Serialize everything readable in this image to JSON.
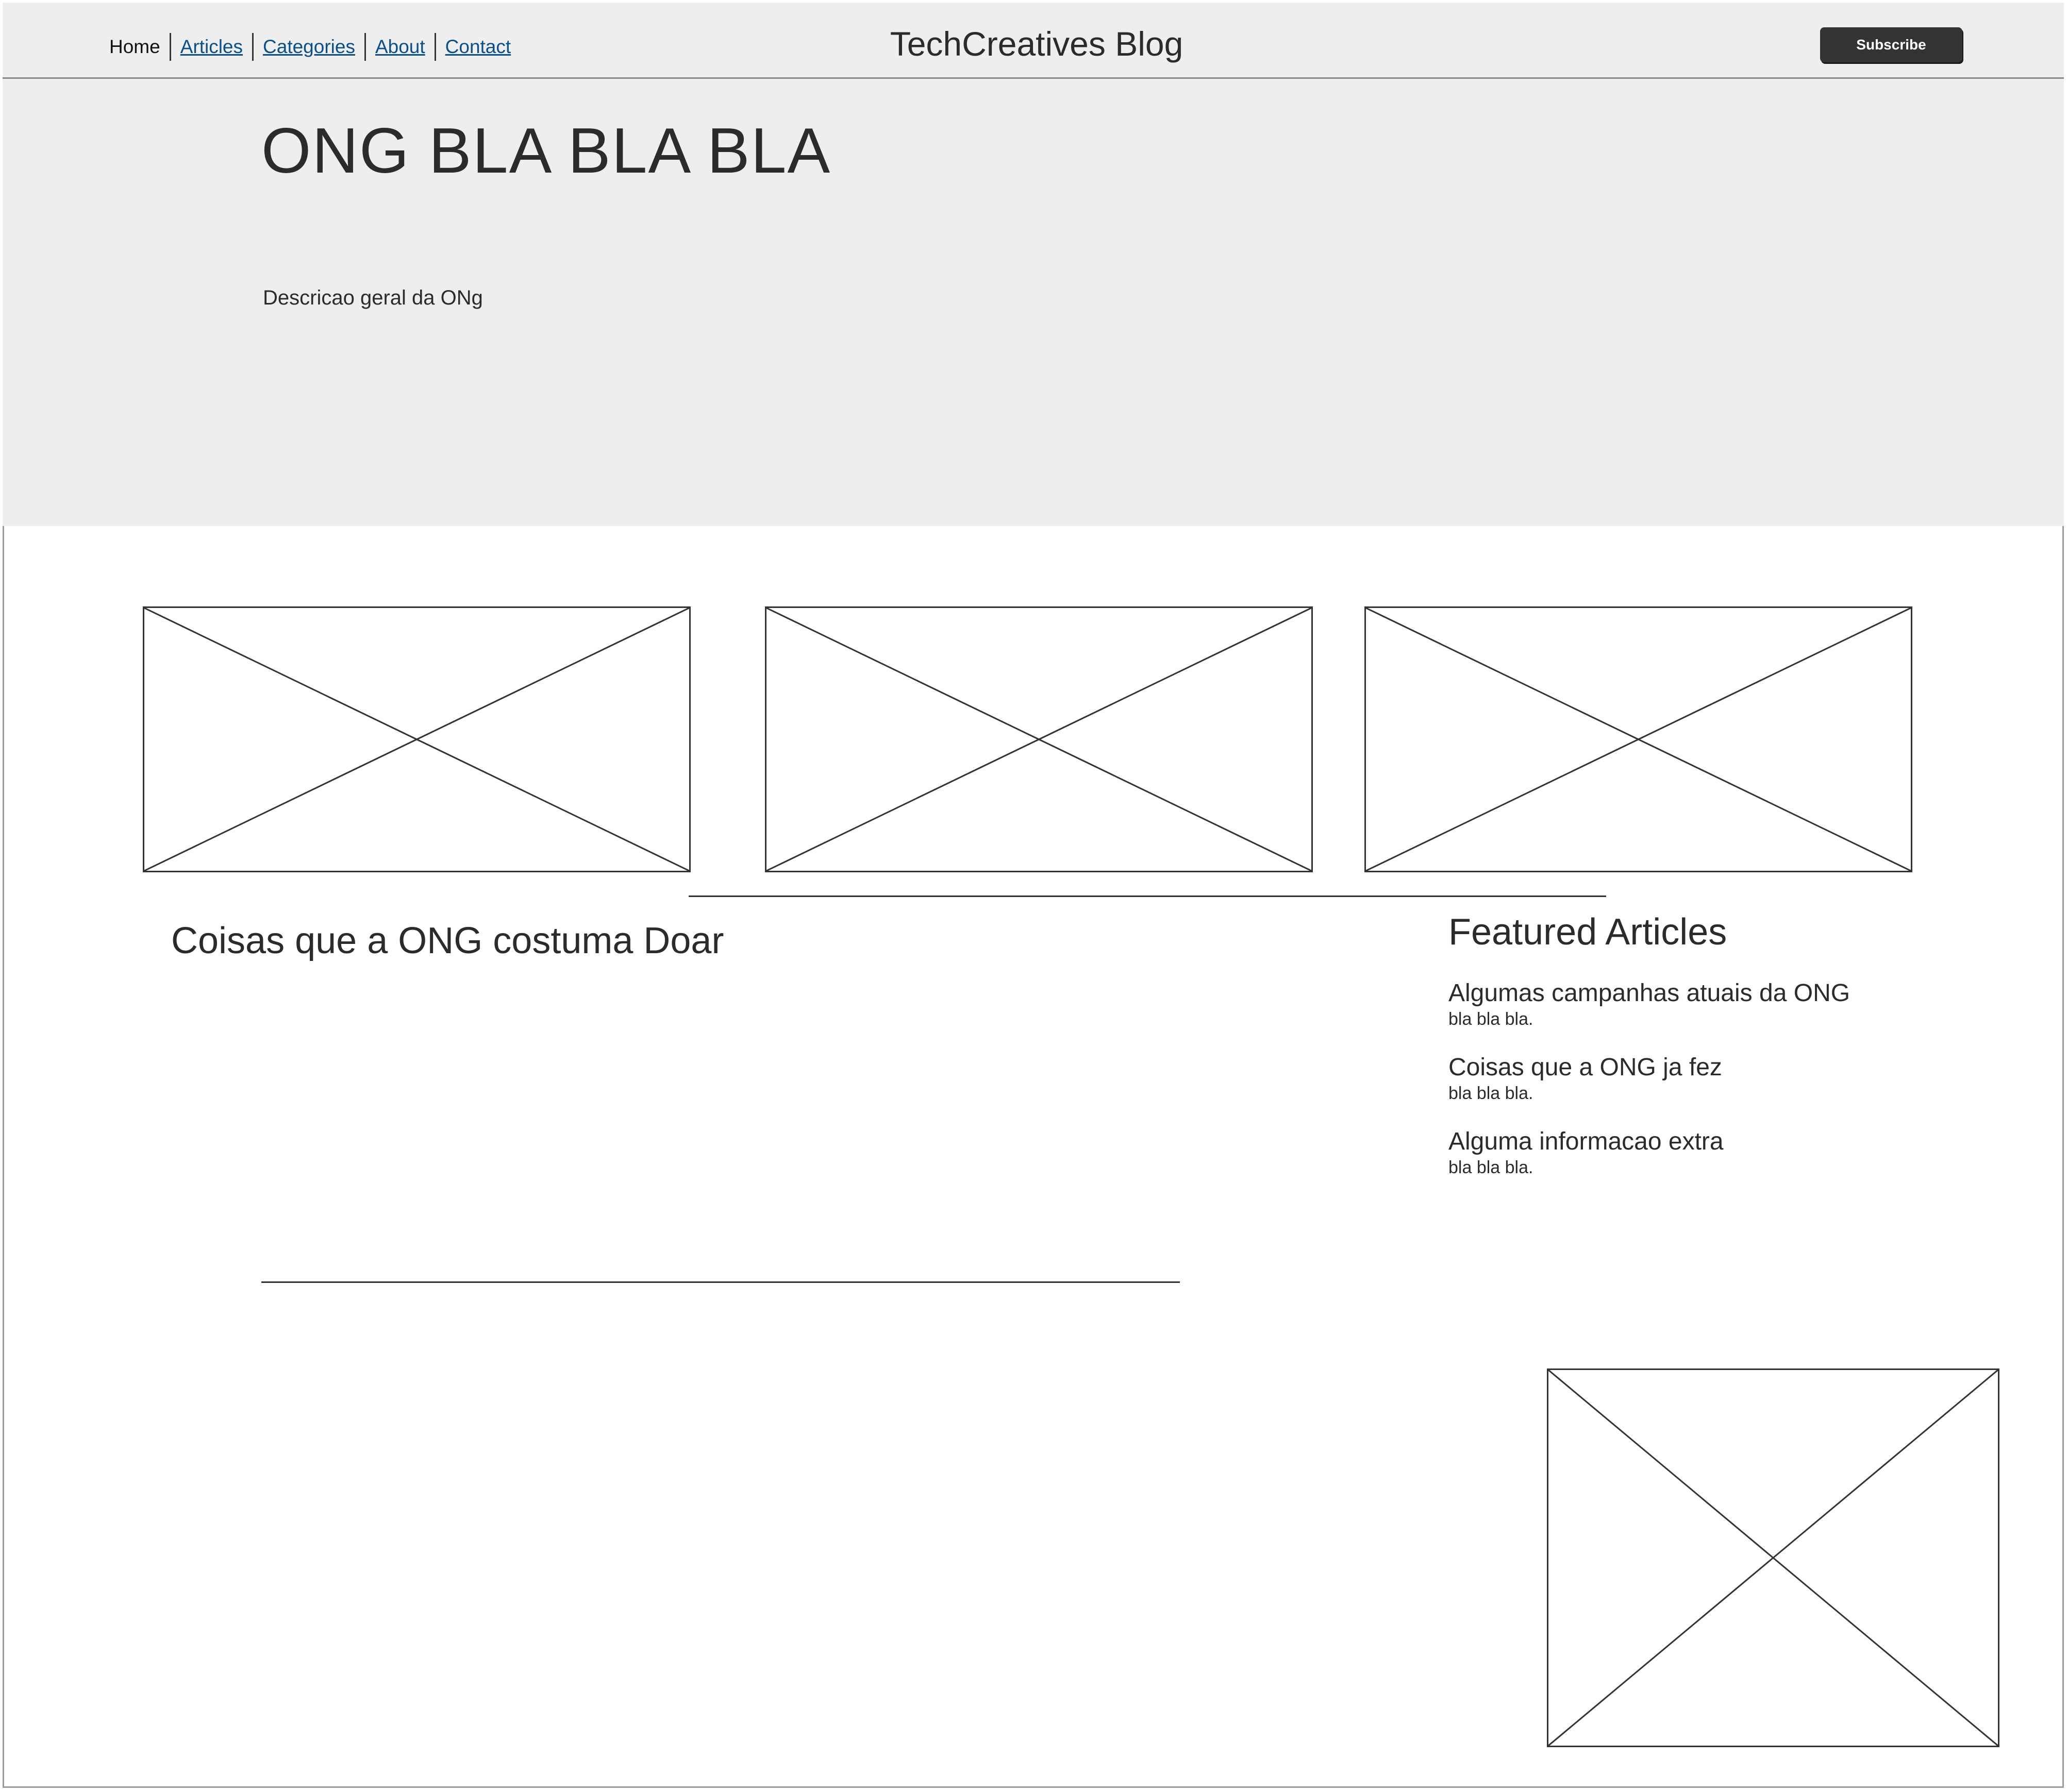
{
  "header": {
    "nav": [
      {
        "label": "Home",
        "current": true
      },
      {
        "label": "Articles",
        "current": false
      },
      {
        "label": "Categories",
        "current": false
      },
      {
        "label": "About",
        "current": false
      },
      {
        "label": "Contact",
        "current": false
      }
    ],
    "site_title": "TechCreatives Blog",
    "subscribe_label": "Subscribe"
  },
  "hero": {
    "title": "ONG BLA BLA BLA",
    "description": "Descricao geral da ONg"
  },
  "main": {
    "section_title": "Coisas que a ONG costuma Doar"
  },
  "featured": {
    "title": "Featured Articles",
    "items": [
      {
        "title": "Algumas campanhas atuais da ONG",
        "desc": "bla bla bla."
      },
      {
        "title": "Coisas que a ONG ja fez",
        "desc": "bla bla bla."
      },
      {
        "title": "Alguma informacao extra",
        "desc": "bla bla bla."
      }
    ]
  },
  "colors": {
    "header_bg": "#eeeeee",
    "hero_bg": "#eeeeee",
    "link": "#0b4f8a",
    "button_bg": "#333333",
    "ink": "#2b2b2b"
  }
}
